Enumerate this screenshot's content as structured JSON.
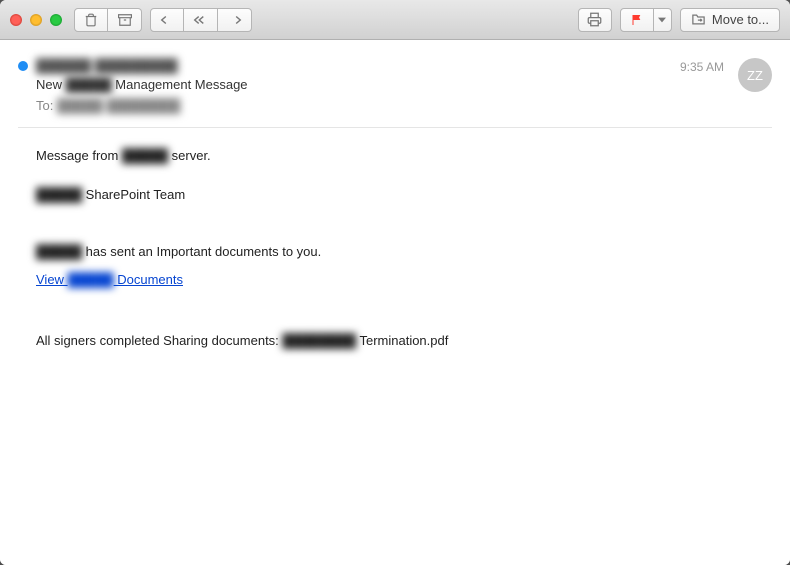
{
  "window": {
    "move_label": "Move to..."
  },
  "header": {
    "sender_name_blurred": "██████ █████████",
    "subject_prefix": "New ",
    "subject_blurred": "█████",
    "subject_suffix": " Management Message",
    "to_label": "To: ",
    "to_recipient_blurred": "█████ ████████",
    "timestamp": "9:35 AM",
    "avatar_initials": "ZZ"
  },
  "body": {
    "line1_prefix": "Message from ",
    "line1_blurred": "█████",
    "line1_suffix": " server.",
    "line2_blurred": "█████",
    "line2_suffix": " SharePoint Team",
    "line3_blurred": "█████",
    "line3_suffix": " has sent an Important documents to you.",
    "link_prefix": "View ",
    "link_blurred": "█████",
    "link_suffix": " Documents",
    "line4_prefix": "All signers completed Sharing documents: ",
    "line4_blurred": "████████",
    "line4_suffix": " Termination.pdf"
  }
}
